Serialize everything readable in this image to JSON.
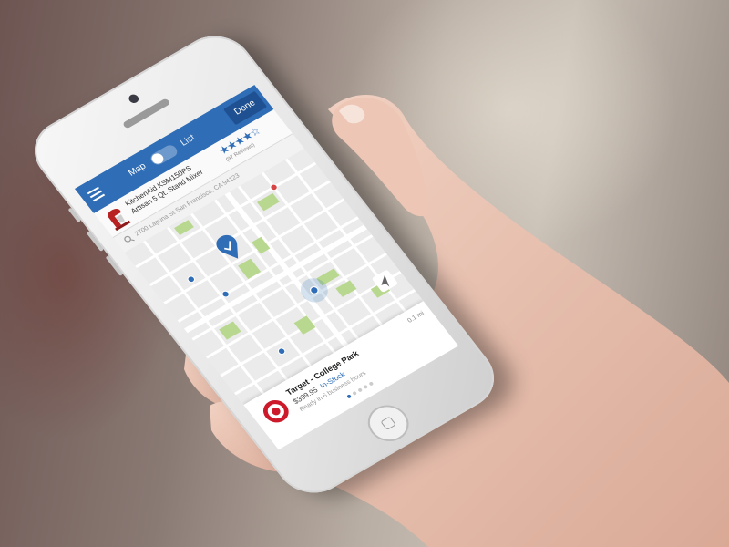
{
  "nav": {
    "map_label": "Map",
    "list_label": "List",
    "done_label": "Done"
  },
  "product": {
    "name_line1": "KitchenAid KSM150PS",
    "name_line2": "Artisan 5 Qt. Stand Mixer",
    "stars": "★★★★☆",
    "rating": 4,
    "reviews": "(97 Reviews)"
  },
  "search": {
    "address": "2700 Laguna St San Francisco, CA 94123"
  },
  "store": {
    "name": "Target - College Park",
    "price": "$399.95",
    "stock": "In-Stock",
    "ready": "Ready in 6 business hours",
    "distance": "0.1 mi"
  },
  "pager": {
    "count": 5,
    "active": 1
  },
  "colors": {
    "brand": "#2f6db6",
    "target_red": "#cc1a2b",
    "park_green": "#b9d88f",
    "pin_red": "#d64545"
  },
  "icons": [
    "menu-icon",
    "mixer-icon",
    "search-icon",
    "location-pin-icon",
    "current-location-icon",
    "navigation-arrow-icon",
    "target-logo-icon"
  ]
}
